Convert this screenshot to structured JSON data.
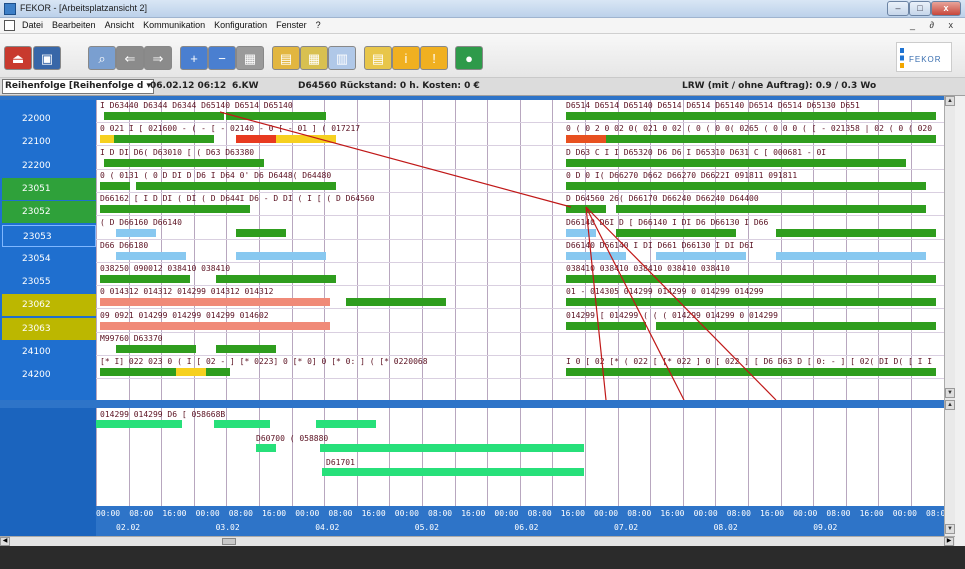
{
  "window": {
    "title": "FEKOR - [Arbeitsplatzansicht 2]",
    "min_label": "–",
    "max_label": "□",
    "close_label": "x"
  },
  "menu": {
    "items": [
      "Datei",
      "Bearbeiten",
      "Ansicht",
      "Kommunikation",
      "Konfiguration",
      "Fenster",
      "?"
    ],
    "mdi": "_ ∂ x"
  },
  "toolbar": {
    "buttons": [
      {
        "name": "exit-button",
        "icon": "exit-icon",
        "color": "#c83a2e"
      },
      {
        "name": "save-button",
        "icon": "save-icon",
        "color": "#3867a8"
      },
      {
        "name": "search-button",
        "icon": "search-icon",
        "color": "#7a9fd0"
      },
      {
        "name": "move-left-button",
        "icon": "arrow-icon",
        "color": "#8b8b8b"
      },
      {
        "name": "move-right-button",
        "icon": "arrow-icon",
        "color": "#8b8b8b"
      },
      {
        "name": "zoom-in-button",
        "icon": "plus-icon",
        "color": "#4a7fd0"
      },
      {
        "name": "zoom-out-button",
        "icon": "minus-icon",
        "color": "#4a7fd0"
      },
      {
        "name": "calendar-button",
        "icon": "calendar-icon",
        "color": "#9a9a9a"
      },
      {
        "name": "view-gantt-button",
        "icon": "gantt-icon",
        "color": "#e2b640"
      },
      {
        "name": "view-grid-button",
        "icon": "grid-icon",
        "color": "#d8c050"
      },
      {
        "name": "view-chart-button",
        "icon": "chart-icon",
        "color": "#b0c8e8"
      },
      {
        "name": "report-button",
        "icon": "report-icon",
        "color": "#e8c64a"
      },
      {
        "name": "info-button",
        "icon": "info-icon",
        "color": "#f0b020"
      },
      {
        "name": "warning-button",
        "icon": "warning-icon",
        "color": "#f0b020"
      },
      {
        "name": "globe-button",
        "icon": "globe-icon",
        "color": "#2e9a4a"
      }
    ],
    "logo_text": "FEKOR"
  },
  "status": {
    "sort_label": "Reihenfolge [Reihenfolge d ▾",
    "datetime": "06.02.12 06:12",
    "week": "6.KW",
    "selected_info": "D64560 Rückstand: 0 h. Kosten: 0 €",
    "lrw": "LRW (mit / ohne Auftrag): 0.9 / 0.3 Wo"
  },
  "resources": [
    "22000",
    "22100",
    "22200",
    "23051",
    "23052",
    "23053",
    "23054",
    "23055",
    "23062",
    "23063",
    "24100",
    "24200"
  ],
  "gantt_rows": [
    {
      "left": "I D63440  D6344 D6344 D65140   D6514 D65140",
      "right": "D6514 D6514 D65140  D6514 D6514 D65140  D6514 D6514 D65130  D651"
    },
    {
      "left": "0 021 I [ 021600  - ( - [  - 02140 - 0 [ - 01 ] ( 017217",
      "right": "0 ( 0 2 0   02 0( 021 0 02 ( 0 ( 0 0( 0265 ( 0 0 0 ( [ - 021358 | 02 ( 0  ( 020"
    },
    {
      "left": "I D DI D6( D63010     [ ( D63 D63380",
      "right": "D D63 C I I D65320      D6 D6 I D65310    D631 C [ 000681       - 0I"
    },
    {
      "left": "0 ( 0131 ( 0 D DI D D6 I D64 0' D6 D6448( D64480",
      "right": "0 D 0 I( D66270        D662 D66270           D6622I 091811   091811"
    },
    {
      "left": "D66162    [ I D DI ( DI ( D D644I D6 - D DI ( I [ ( D D64560",
      "right": "D D64560 26( D66170                 D66240   D66240 D64400"
    },
    {
      "left": "( D D66160                  D66140",
      "right": "D66140     D6I D  [ D66140        I DI D6 D66130     I D66"
    },
    {
      "left": "D66 D66180",
      "right": "D66140      D66140      I DI D661 D66130    I DI D6I"
    },
    {
      "left": "038250  090012      038410                 038410",
      "right": "038410        038410   038410      038410     038410"
    },
    {
      "left": "0 014312     014312  014299      014312  014312",
      "right": "01 - 014305  014299    014299        0 014299    014299"
    },
    {
      "left": "09 0921 014299   014299       014299       014602",
      "right": "014299     [ 014299      ( ( ( 014299     014299    0 014299"
    },
    {
      "left": "M99760     D63370",
      "right": ""
    },
    {
      "left": "[* I] 022 023 0 ( I [ 02 - ] [* 0223] 0 [* 0] 0 [* 0: ] ( [* 0220068",
      "right": "I 0 [ 02 [* ( 022 [ [* 022 ] 0 [ 022 ] [ D6 D63 D [ 0: - ] [ 02( DI  D( [ I I"
    }
  ],
  "bottom_rows": [
    {
      "left": "014299            014299            D6 [ 058668B"
    },
    {
      "left": "D60700          ( 058880"
    },
    {
      "left": "D61701"
    }
  ],
  "axis": {
    "times": [
      "00:00",
      "08:00",
      "16:00",
      "00:00",
      "08:00",
      "16:00",
      "00:00",
      "08:00",
      "16:00",
      "00:00",
      "08:00",
      "16:00",
      "00:00",
      "08:00",
      "16:00",
      "00:00",
      "08:00",
      "16:00",
      "00:00",
      "08:00",
      "16:00",
      "00:00",
      "08:00",
      "16:00",
      "00:00",
      "08:0("
    ],
    "dates": [
      "02.02",
      "03.02",
      "04.02",
      "05.02",
      "06.02",
      "07.02",
      "08.02",
      "09.02"
    ]
  },
  "colors": {
    "panel": "#2e74c8",
    "row_green": "#2fa13a",
    "row_olive": "#bcb700",
    "bar_green": "#2f9d1e",
    "bar_blue": "#88c8f0",
    "bar_salmon": "#f08a78",
    "bar_mint": "#27e07a",
    "link_red": "#c01818"
  }
}
